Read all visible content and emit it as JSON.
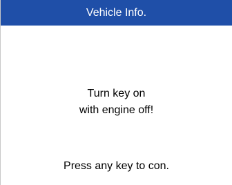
{
  "header": {
    "title": "Vehicle Info."
  },
  "message": {
    "line1": "Turn key on",
    "line2": "with engine off!"
  },
  "footer": {
    "prompt": "Press any key to con."
  },
  "colors": {
    "title_bar": "#1f4fa8",
    "title_text": "#ffffff",
    "background": "#ffffff",
    "text": "#000000"
  }
}
